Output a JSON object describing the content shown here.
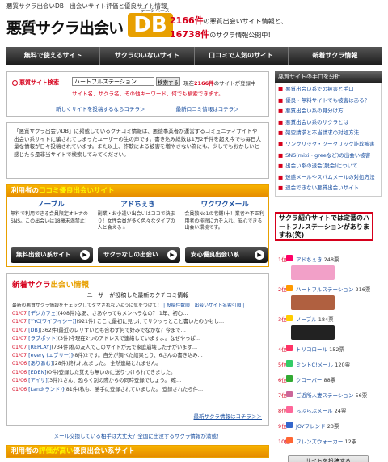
{
  "header": {
    "small_title": "悪質サクラ出会いDB　出会いサイト評価と優良サイト情報",
    "logo_text": "悪質サクラ出会い",
    "logo_db": "DB",
    "logo_db_sub": "データベース",
    "stat1_num": "2166件",
    "stat1_text": "の悪質出会いサイト情報と、",
    "stat2_num": "16738件",
    "stat2_text": "のサクラ情報公開中！"
  },
  "nav": [
    "無料で使えるサイト",
    "サクラのいないサイト",
    "口コミで人気のサイト",
    "新着サクラ情報"
  ],
  "search": {
    "label": "悪質サイト検索",
    "value": "ハートフルステーション",
    "button": "検索する",
    "count_pre": "現在",
    "count_num": "2166件",
    "count_post": "のサイトが登録中",
    "hint": "サイト名、サクラ名、その他キーワード、何でも検索できます。",
    "link1": "新しくサイトを投稿するならコチラ＞",
    "link2": "最新口コミ情報はコチラ＞"
  },
  "intro": "「悪質サクラ出会いDB」に掲載しているクチコミ情報は、悪徳事業者が運営するコミュニティサイトや出会い系サイトに騙されてしまったユーザーの生の声です。書き込み総数は1万2千件を超え今でも毎日大量な情報が日々投稿されています。また以上、詐欺による被害を増やさない為にも、少しでもおかしいと感じたら是非当サイトで検索してみてください。",
  "kuchi": {
    "head_pre": "利用者の",
    "head_hl": "口コミ優良出会いサイト",
    "cols": [
      {
        "name": "ノーブル",
        "desc": "無料で利用できる会員限定オトナのSNS。この出会いは18歳未満禁止！"
      },
      {
        "name": "アドちぇき",
        "desc": "副業・お小遣い出会いはココで決まり！女性会員が多く色々なタイプの人と会える☆"
      },
      {
        "name": "ワクワクメール",
        "desc": "会員数No1の老舗!十！業者や不正利用者の排除に力を入れ、安心できる出会い環境です。"
      }
    ],
    "buttons": [
      "無料出会い系サイト",
      "サクラなしの出会い",
      "安心優良出会い系"
    ]
  },
  "news": {
    "head_pre": "新着サクラ",
    "head_post": "出会い情報",
    "sub": "ユーザーが投稿した最新のクチコミ情報",
    "bar": "最新の悪質サクラ情報をチェックしてダマされないように気をつけて！",
    "bar_links": "| 投稿件数順 | 出会いサイト名索引順 |",
    "items": [
      {
        "d": "01/07",
        "s": "[デジカフェ]",
        "t": "(408件)なあ、さあやってもメンヘラなの？ 1年、初心…"
      },
      {
        "d": "01/07",
        "s": "[YYC(ワイワイシー)]",
        "t": "(921件) ここに最初に見つけてサクッっとこと書いたのかもし…"
      },
      {
        "d": "01/07",
        "s": "[DB]",
        "t": "(362件)最近のレリすいとも合わず何で好みでなかな？今まで…"
      },
      {
        "d": "01/07",
        "s": "[ラブポット]",
        "t": "(3件)今現在2つのアドレスで連絡していますよ。なぜやっぱ…"
      },
      {
        "d": "01/07",
        "s": "[REPLAY]",
        "t": "(734件)私の友人でこのサイトが元で家庭崩壊した子がいます…"
      },
      {
        "d": "01/07",
        "s": "[every (エブリー)]",
        "t": "(8件)2です。自分が調べた結果とり、6さんの書き込み…"
      },
      {
        "d": "01/06",
        "s": "[ありあむ]",
        "t": "(28件)終われれました。 全然連絡とれません。"
      },
      {
        "d": "01/06",
        "s": "[EDEN]",
        "t": "(0件)登録した覚えも無いのに送りつけられてきました。"
      },
      {
        "d": "01/06",
        "s": "[アイサ]",
        "t": "(3件)1さん、恐らく別の際からの同時登録でしょう。 確…"
      },
      {
        "d": "01/06",
        "s": "[Land(ランド)]",
        "t": "(81件)私も、勝手に登録されていました。 登録されたら件…"
      }
    ],
    "more": "最新サクラ情報はコチラ＞＞"
  },
  "foot_note": "メール交換している相手は大丈夫？全国に出没するサクラ情報が満載！",
  "bottom_head_pre": "利用者の",
  "bottom_head_hl": "評価が高い",
  "bottom_head_post": "優良出会い系サイト",
  "sidebar": {
    "title": "悪質サイトの手口を分析",
    "items": [
      "悪質出会い系での被害と手口",
      "優良・無料サイトでも被害はある？",
      "悪質出会い系の見分け方",
      "悪質出会い系のサクラとは",
      "架空請求と不当請求の対処方法",
      "ワンクリック・ツークリック詐欺被害",
      "SNS(mixi・greeなど)の出会い被害",
      "出会い系の退会(脱会)について",
      "迷惑メールやスパムメールの対処方法",
      "退会できない悪質出会いサイト"
    ]
  },
  "callout": "サクラ紹介サイトでは定番のハートフルステーションがありますね(笑)",
  "ranking": [
    {
      "pos": "1位",
      "name": "アドちぇき",
      "cnt": "248票",
      "banner": true,
      "bcolor": "#f2a0c8",
      "icon": "#f06"
    },
    {
      "pos": "2位",
      "name": "ハートフルステーション",
      "cnt": "216票",
      "banner": true,
      "bcolor": "#b06040",
      "icon": "#f90"
    },
    {
      "pos": "3位",
      "name": "ノーブル",
      "cnt": "184票",
      "banner": true,
      "bcolor": "#222222",
      "icon": "#fc0"
    },
    {
      "pos": "4位",
      "name": "トリコロール",
      "cnt": "152票",
      "banner": false,
      "icon": "#f36"
    },
    {
      "pos": "5位",
      "name": "ミントC!メール",
      "cnt": "120票",
      "banner": false,
      "icon": "#3c6"
    },
    {
      "pos": "6位",
      "name": "クローバー",
      "cnt": "88票",
      "banner": false,
      "icon": "#3a3"
    },
    {
      "pos": "7位",
      "name": "ご近所人妻ステーション",
      "cnt": "56票",
      "banner": false,
      "icon": "#c69"
    },
    {
      "pos": "8位",
      "name": "らぶらぶメール",
      "cnt": "24票",
      "banner": false,
      "icon": "#f69"
    },
    {
      "pos": "9位",
      "name": "JOYフレンド",
      "cnt": "23票",
      "banner": false,
      "icon": "#36c"
    },
    {
      "pos": "10位",
      "name": "フレンズウォーカー",
      "cnt": "12票",
      "banner": false,
      "icon": "#f63"
    }
  ],
  "register_button": "サイトを投稿する"
}
